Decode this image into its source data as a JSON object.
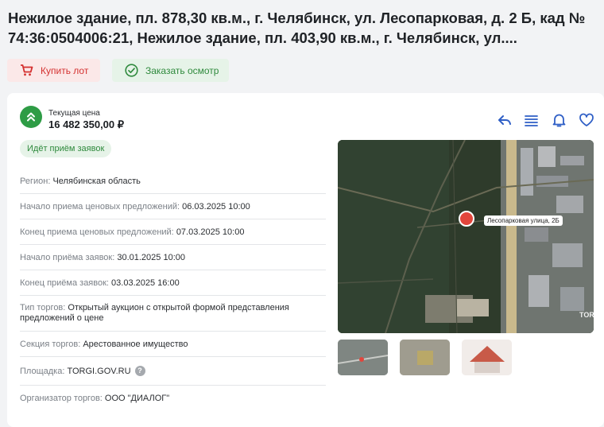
{
  "header": {
    "title": "Нежилое здание, пл. 878,30 кв.м., г. Челябинск, ул. Лесопарковая, д. 2 Б, кад № 74:36:0504006:21, Нежилое здание, пл. 403,90 кв.м., г. Челябинск, ул...."
  },
  "buttons": {
    "buy": "Купить лот",
    "view": "Заказать осмотр"
  },
  "price": {
    "label": "Текущая цена",
    "value": "16 482 350,00 ₽"
  },
  "status": "Идёт приём заявок",
  "details": [
    {
      "key": "Регион:",
      "value": "Челябинская область"
    },
    {
      "key": "Начало приема ценовых предложений:",
      "value": "06.03.2025 10:00"
    },
    {
      "key": "Конец приема ценовых предложений:",
      "value": "07.03.2025 10:00"
    },
    {
      "key": "Начало приёма заявок:",
      "value": "30.01.2025 10:00"
    },
    {
      "key": "Конец приёма заявок:",
      "value": "03.03.2025 16:00"
    },
    {
      "key": "Тип торгов:",
      "value": "Открытый аукцион с открытой формой представления предложений о цене"
    },
    {
      "key": "Секция торгов:",
      "value": "Арестованное имущество"
    },
    {
      "key": "Площадка:",
      "value": "TORGI.GOV.RU"
    },
    {
      "key": "Организатор торгов:",
      "value": "ООО \"ДИАЛОГ\""
    }
  ],
  "map": {
    "pin_label": "Лесопарковая улица, 2Б",
    "watermark": "TORGI"
  },
  "colors": {
    "accent_green": "#2e9c45",
    "buy_red": "#d4302f",
    "icon_blue": "#2f5fc6"
  },
  "icons": [
    "cart-icon",
    "check-circle-icon",
    "chevron-up-icon",
    "share-icon",
    "list-icon",
    "bell-icon",
    "heart-icon",
    "help-icon",
    "map-pin-icon"
  ]
}
